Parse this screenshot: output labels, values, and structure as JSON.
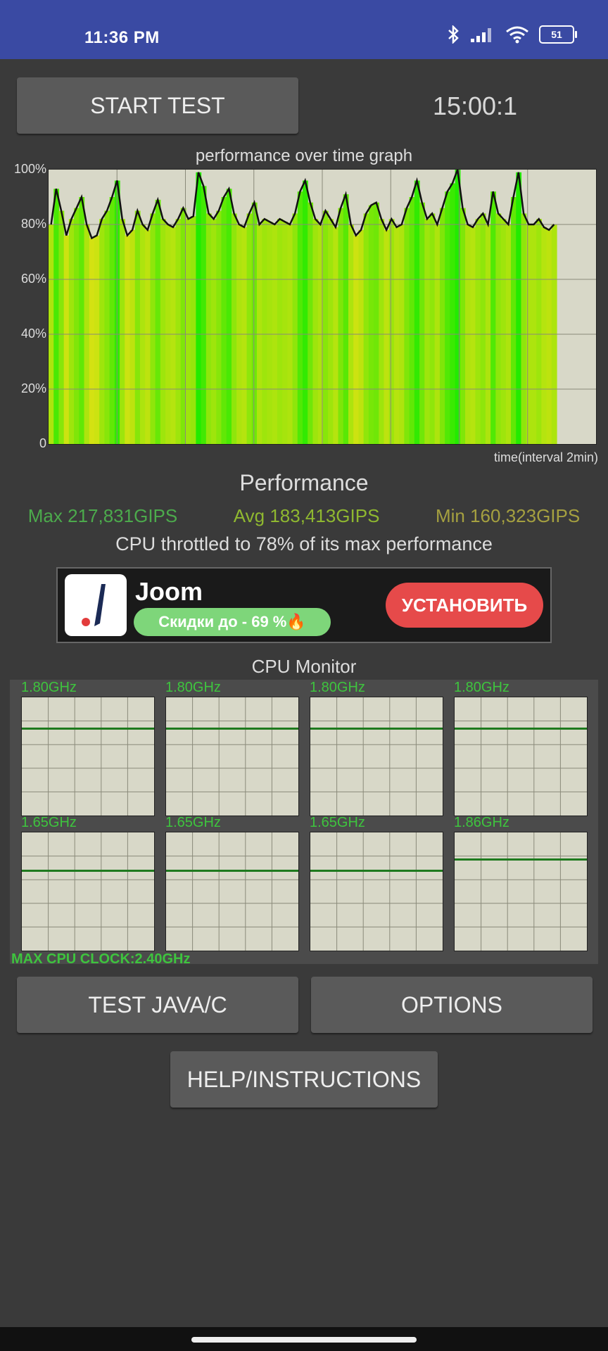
{
  "status_bar": {
    "time": "11:36 PM",
    "battery": "51",
    "icons": [
      "bluetooth-icon",
      "signal-icon",
      "wifi-icon",
      "battery-icon"
    ]
  },
  "controls": {
    "start_label": "START TEST",
    "timer": "15:00:1",
    "test_java_label": "TEST JAVA/C",
    "options_label": "OPTIONS",
    "help_label": "HELP/INSTRUCTIONS"
  },
  "graph": {
    "title": "performance over time graph",
    "x_label": "time(interval 2min)",
    "y_ticks": [
      "100%",
      "80%",
      "60%",
      "40%",
      "20%",
      "0"
    ]
  },
  "chart_data": {
    "type": "area",
    "title": "performance over time graph",
    "xlabel": "time(interval 2min)",
    "ylabel": "",
    "ylim": [
      0,
      100
    ],
    "grid": true,
    "values": [
      80,
      93,
      85,
      76,
      82,
      86,
      90,
      80,
      75,
      76,
      82,
      85,
      90,
      96,
      82,
      76,
      78,
      85,
      80,
      78,
      84,
      89,
      82,
      80,
      79,
      82,
      86,
      82,
      83,
      99,
      94,
      84,
      82,
      85,
      90,
      93,
      84,
      80,
      79,
      84,
      88,
      80,
      82,
      81,
      80,
      82,
      81,
      80,
      84,
      92,
      96,
      88,
      82,
      80,
      85,
      82,
      79,
      86,
      91,
      80,
      76,
      78,
      84,
      87,
      88,
      82,
      78,
      82,
      79,
      80,
      86,
      90,
      96,
      88,
      82,
      84,
      80,
      86,
      92,
      95,
      100,
      86,
      80,
      79,
      82,
      84,
      80,
      92,
      84,
      82,
      80,
      90,
      99,
      84,
      80,
      80,
      82,
      79,
      78,
      80
    ]
  },
  "performance": {
    "title": "Performance",
    "max": "Max 217,831GIPS",
    "avg": "Avg 183,413GIPS",
    "min": "Min 160,323GIPS",
    "throttle": "CPU throttled to 78% of its max performance",
    "colors": {
      "max": "#4caa4c",
      "avg": "#8fb830",
      "min": "#a5a040"
    }
  },
  "ad": {
    "name": "Joom",
    "tagline": "Скидки до - 69 %🔥",
    "install_label": "УСТАНОВИТЬ"
  },
  "cpu_monitor": {
    "title": "CPU Monitor",
    "max_clock": "MAX CPU CLOCK:2.40GHz",
    "cores": [
      {
        "label": "1.80GHz",
        "level": 0.75
      },
      {
        "label": "1.80GHz",
        "level": 0.75
      },
      {
        "label": "1.80GHz",
        "level": 0.75
      },
      {
        "label": "1.80GHz",
        "level": 0.75
      },
      {
        "label": "1.65GHz",
        "level": 0.69
      },
      {
        "label": "1.65GHz",
        "level": 0.69
      },
      {
        "label": "1.65GHz",
        "level": 0.69
      },
      {
        "label": "1.86GHz",
        "level": 0.78
      }
    ]
  }
}
